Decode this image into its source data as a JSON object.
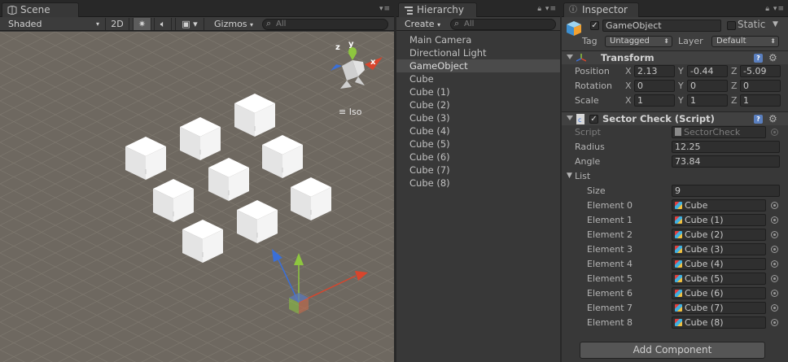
{
  "scene": {
    "tab_label": "Scene",
    "shading_mode": "Shaded",
    "mode_2d": "2D",
    "gizmos_label": "Gizmos",
    "search_placeholder": "All",
    "projection_label": "Iso",
    "gizmo_axes": {
      "x": "x",
      "y": "y",
      "z": "z"
    }
  },
  "hierarchy": {
    "tab_label": "Hierarchy",
    "create_label": "Create",
    "search_placeholder": "All",
    "items": [
      {
        "label": "Main Camera",
        "selected": false
      },
      {
        "label": "Directional Light",
        "selected": false
      },
      {
        "label": "GameObject",
        "selected": true
      },
      {
        "label": "Cube",
        "selected": false
      },
      {
        "label": "Cube (1)",
        "selected": false
      },
      {
        "label": "Cube (2)",
        "selected": false
      },
      {
        "label": "Cube (3)",
        "selected": false
      },
      {
        "label": "Cube (4)",
        "selected": false
      },
      {
        "label": "Cube (5)",
        "selected": false
      },
      {
        "label": "Cube (6)",
        "selected": false
      },
      {
        "label": "Cube (7)",
        "selected": false
      },
      {
        "label": "Cube (8)",
        "selected": false
      }
    ]
  },
  "inspector": {
    "tab_label": "Inspector",
    "object_name": "GameObject",
    "static_label": "Static",
    "tag_label": "Tag",
    "tag_value": "Untagged",
    "layer_label": "Layer",
    "layer_value": "Default",
    "transform": {
      "title": "Transform",
      "position_label": "Position",
      "rotation_label": "Rotation",
      "scale_label": "Scale",
      "axis_x": "X",
      "axis_y": "Y",
      "axis_z": "Z",
      "position": {
        "x": "2.13",
        "y": "-0.44",
        "z": "-5.09"
      },
      "rotation": {
        "x": "0",
        "y": "0",
        "z": "0"
      },
      "scale": {
        "x": "1",
        "y": "1",
        "z": "1"
      }
    },
    "sector_check": {
      "title": "Sector Check (Script)",
      "script_label": "Script",
      "script_value": "SectorCheck",
      "radius_label": "Radius",
      "radius_value": "12.25",
      "angle_label": "Angle",
      "angle_value": "73.84",
      "list_label": "List",
      "size_label": "Size",
      "size_value": "9",
      "elements": [
        {
          "label": "Element 0",
          "value": "Cube"
        },
        {
          "label": "Element 1",
          "value": "Cube (1)"
        },
        {
          "label": "Element 2",
          "value": "Cube (2)"
        },
        {
          "label": "Element 3",
          "value": "Cube (3)"
        },
        {
          "label": "Element 4",
          "value": "Cube (4)"
        },
        {
          "label": "Element 5",
          "value": "Cube (5)"
        },
        {
          "label": "Element 6",
          "value": "Cube (6)"
        },
        {
          "label": "Element 7",
          "value": "Cube (7)"
        },
        {
          "label": "Element 8",
          "value": "Cube (8)"
        }
      ]
    },
    "add_component_label": "Add Component"
  },
  "colors": {
    "panel_bg": "#383838",
    "scene_bg": "#6e6860",
    "selection": "#4b4b4b",
    "axis_x": "#d8452c",
    "axis_y": "#8ec63f",
    "axis_z": "#3a6fd8"
  }
}
